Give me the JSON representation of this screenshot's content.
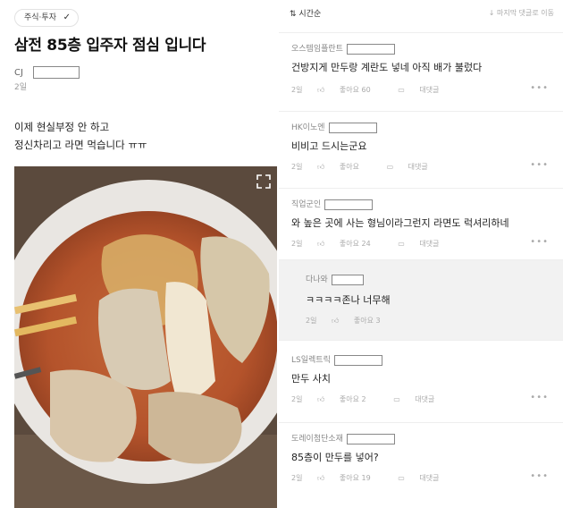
{
  "post": {
    "tag": "주식·투자",
    "title": "삼전 85층 입주자 점심 입니다",
    "author": "CJ",
    "date": "2일",
    "body": [
      "이제 현실부정 안 하고",
      "정신차리고 라면 먹습니다 ㅠㅠ"
    ]
  },
  "comments_header": {
    "sort_label": "시간순",
    "jump_label": "마지막 댓글로 이동"
  },
  "comments": [
    {
      "author": "오스템임플란트",
      "text": "건방지게 만두랑 계란도 넣네 아직 배가 불렀다",
      "date": "2일",
      "likes": "좋아요 60",
      "reply": "대댓글"
    },
    {
      "author": "HK이노엔",
      "text": "비비고 드시는군요",
      "date": "2일",
      "likes": "좋아요",
      "reply": "대댓글"
    },
    {
      "author": "직업군인",
      "text": "와 높은 곳에 사는 형님이라그런지 라면도 럭셔리하네",
      "date": "2일",
      "likes": "좋아요 24",
      "reply": "대댓글"
    },
    {
      "author": "다나와",
      "text": "ㅋㅋㅋㅋ존나 너무해",
      "date": "2일",
      "likes": "좋아요 3",
      "reply": ""
    },
    {
      "author": "LS일렉트릭",
      "text": "만두 사치",
      "date": "2일",
      "likes": "좋아요 2",
      "reply": "대댓글"
    },
    {
      "author": "도레이첨단소재",
      "text": "85층이 만두를 넣어?",
      "date": "2일",
      "likes": "좋아요 19",
      "reply": "대댓글"
    }
  ]
}
